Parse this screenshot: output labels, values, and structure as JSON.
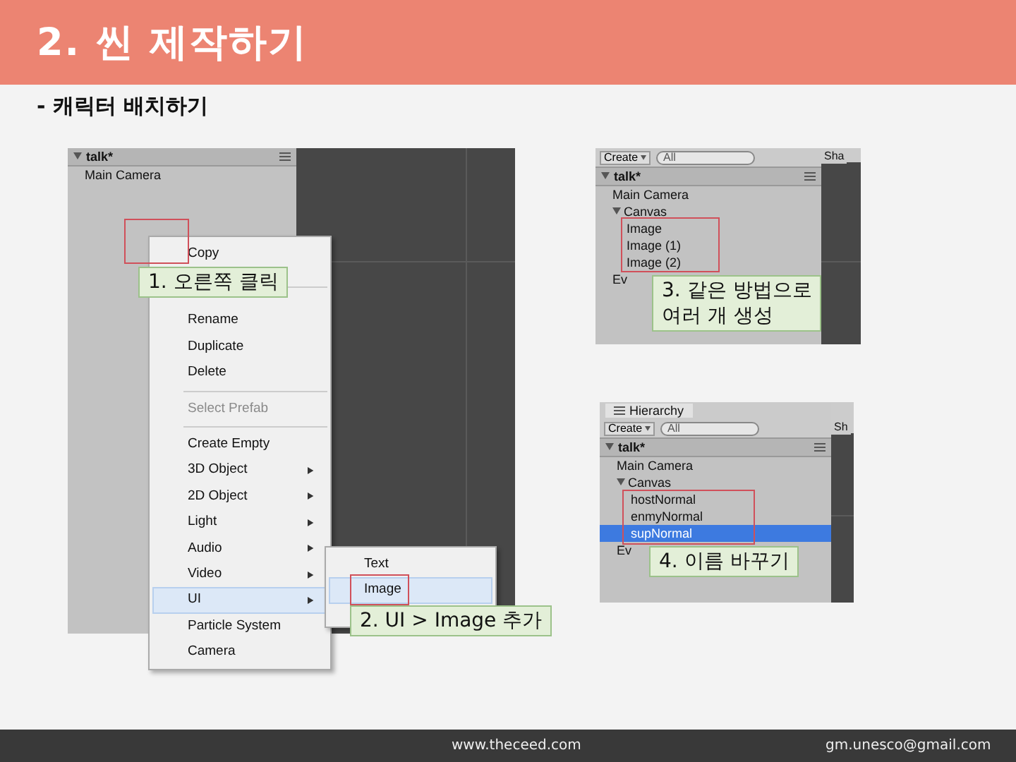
{
  "header": {
    "title": "2. 씬 제작하기"
  },
  "subtitle": "- 캐릭터 배치하기",
  "context_screenshot": {
    "scene": "talk*",
    "tree": [
      {
        "label": "Main Camera",
        "selected": false
      }
    ],
    "menu": [
      {
        "kind": "item",
        "label": "Copy",
        "disabled": false,
        "submenu": false,
        "selected": false
      },
      {
        "kind": "separator"
      },
      {
        "kind": "item",
        "label": "Rename",
        "disabled": false,
        "submenu": false,
        "selected": false
      },
      {
        "kind": "item",
        "label": "Duplicate",
        "disabled": false,
        "submenu": false,
        "selected": false
      },
      {
        "kind": "item",
        "label": "Delete",
        "disabled": false,
        "submenu": false,
        "selected": false
      },
      {
        "kind": "separator"
      },
      {
        "kind": "item",
        "label": "Select Prefab",
        "disabled": true,
        "submenu": false,
        "selected": false
      },
      {
        "kind": "separator"
      },
      {
        "kind": "item",
        "label": "Create Empty",
        "disabled": false,
        "submenu": false,
        "selected": false
      },
      {
        "kind": "item",
        "label": "3D Object",
        "disabled": false,
        "submenu": true,
        "selected": false
      },
      {
        "kind": "item",
        "label": "2D Object",
        "disabled": false,
        "submenu": true,
        "selected": false
      },
      {
        "kind": "item",
        "label": "Light",
        "disabled": false,
        "submenu": true,
        "selected": false
      },
      {
        "kind": "item",
        "label": "Audio",
        "disabled": false,
        "submenu": true,
        "selected": false
      },
      {
        "kind": "item",
        "label": "Video",
        "disabled": false,
        "submenu": true,
        "selected": false
      },
      {
        "kind": "item",
        "label": "UI",
        "disabled": false,
        "submenu": true,
        "selected": true
      },
      {
        "kind": "item",
        "label": "Particle System",
        "disabled": false,
        "submenu": false,
        "selected": false
      },
      {
        "kind": "item",
        "label": "Camera",
        "disabled": false,
        "submenu": false,
        "selected": false
      }
    ],
    "submenu": [
      {
        "label": "Text",
        "selected": false
      },
      {
        "label": "Image",
        "selected": true
      }
    ]
  },
  "copies_screenshot": {
    "create": "Create",
    "placeholder": "All",
    "side_tab": "Sha",
    "scene": "talk*",
    "tree": [
      {
        "label": "Main Camera",
        "selected": false
      },
      {
        "label": "Canvas",
        "selected": false,
        "expanded": true,
        "children": [
          {
            "label": "Image",
            "selected": false
          },
          {
            "label": "Image (1)",
            "selected": false
          },
          {
            "label": "Image (2)",
            "selected": false
          }
        ]
      },
      {
        "label": "Ev",
        "selected": false
      }
    ]
  },
  "rename_screenshot": {
    "tab": "Hierarchy",
    "create": "Create",
    "placeholder": "All",
    "side_tab": "Sh",
    "scene": "talk*",
    "tree": [
      {
        "label": "Main Camera",
        "selected": false
      },
      {
        "label": "Canvas",
        "selected": false,
        "expanded": true,
        "children": [
          {
            "label": "hostNormal",
            "selected": false
          },
          {
            "label": "enmyNormal",
            "selected": false
          },
          {
            "label": "supNormal",
            "selected": true
          }
        ]
      },
      {
        "label": "Ev",
        "selected": false
      }
    ]
  },
  "callouts": [
    "1. 오른쪽 클릭",
    "2. UI > Image 추가",
    "3. 같은 방법으로\n여러 개 생성",
    "4. 이름 바꾸기"
  ],
  "footer": {
    "website": "www.theceed.com",
    "email": "gm.unesco@gmail.com"
  }
}
